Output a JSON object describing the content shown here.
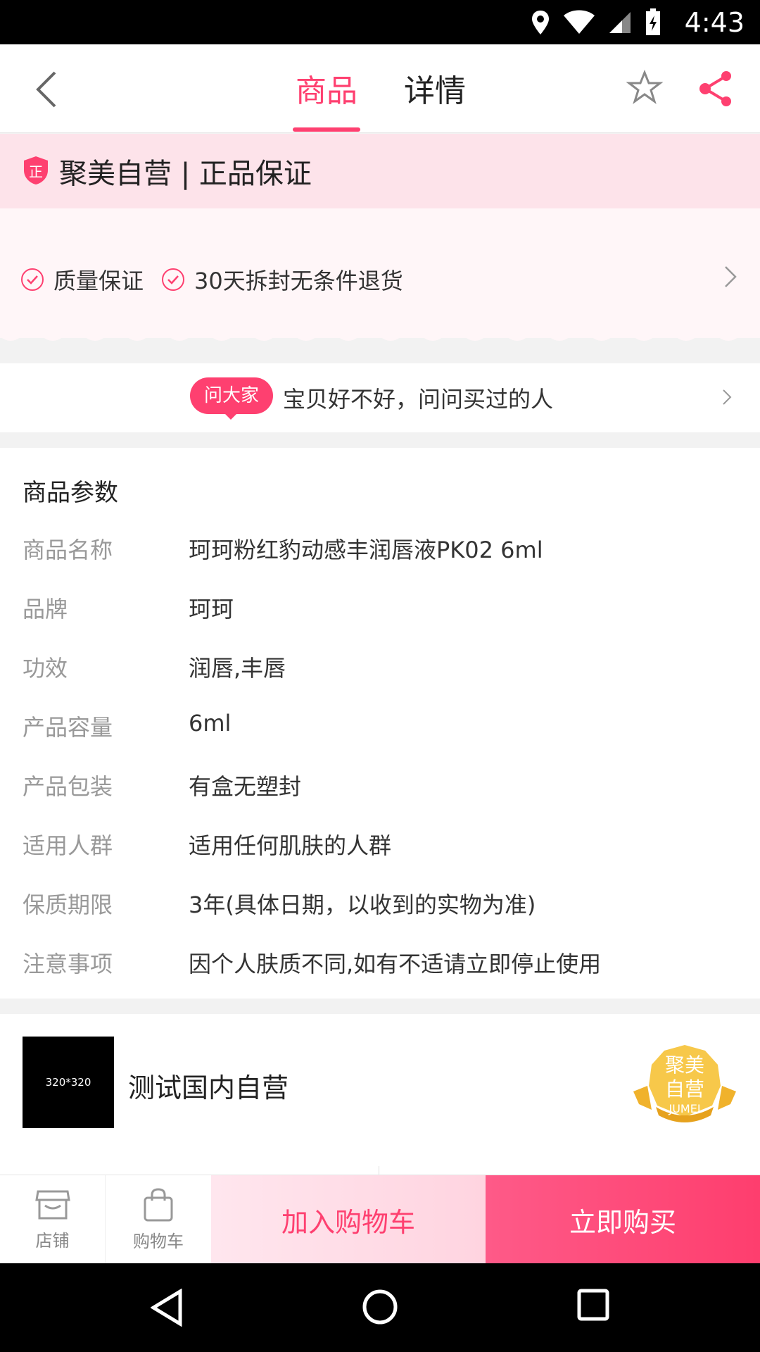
{
  "status_bar": {
    "time": "4:43"
  },
  "nav": {
    "tabs": [
      {
        "label": "商品",
        "active": true
      },
      {
        "label": "详情",
        "active": false
      }
    ]
  },
  "guarantee": {
    "badge_char": "正",
    "title": "聚美自营 | 正品保证"
  },
  "service": {
    "items": [
      "质量保证",
      "30天拆封无条件退货"
    ]
  },
  "ask": {
    "pill": "问大家",
    "text": "宝贝好不好，问问买过的人"
  },
  "params": {
    "heading": "商品参数",
    "rows": [
      {
        "key": "商品名称",
        "value": "珂珂粉红豹动感丰润唇液PK02 6ml"
      },
      {
        "key": "品牌",
        "value": "珂珂"
      },
      {
        "key": "功效",
        "value": "润唇,丰唇"
      },
      {
        "key": "产品容量",
        "value": "6ml"
      },
      {
        "key": "产品包装",
        "value": "有盒无塑封"
      },
      {
        "key": "适用人群",
        "value": "适用任何肌肤的人群"
      },
      {
        "key": "保质期限",
        "value": "3年(具体日期，以收到的实物为准)"
      },
      {
        "key": "注意事项",
        "value": "因个人肤质不同,如有不适请立即停止使用"
      }
    ]
  },
  "store": {
    "logo_text": "320*320",
    "name": "测试国内自营",
    "medal_line1": "聚美",
    "medal_line2": "自营",
    "medal_en": "JUMEI"
  },
  "bottom_bar": {
    "store_label": "店铺",
    "cart_label": "购物车",
    "add_to_cart": "加入购物车",
    "buy_now": "立即购买"
  },
  "colors": {
    "accent": "#fe4070",
    "guarantee_bg": "#fde3ea"
  }
}
